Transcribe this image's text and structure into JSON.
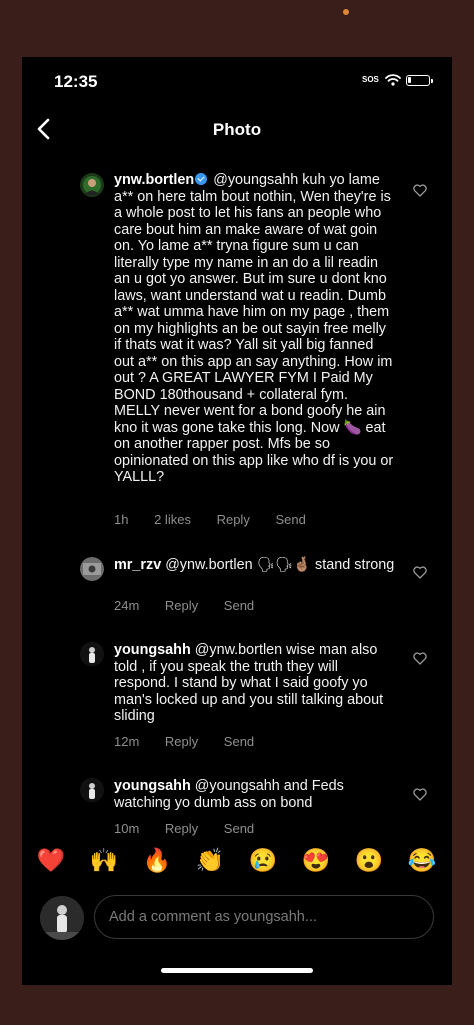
{
  "status_bar": {
    "time": "12:35",
    "sos": "SOS"
  },
  "nav": {
    "title": "Photo"
  },
  "comments": [
    {
      "username": "ynw.bortlen",
      "verified": true,
      "text": "@youngsahh kuh yo lame a** on here talm bout nothin, Wen they're is a whole post to let his fans an people who care bout him an make aware of wat goin on. Yo lame a** tryna figure sum u can literally type my name in an do a lil readin an u got yo answer. But im sure u dont kno laws, want understand wat u readin. Dumb a** wat umma have him on my page , them on my highlights an be out sayin free melly if thats wat it was? Yall sit yall big fanned out a** on this app an say anything. How im out ? A GREAT LAWYER FYM I Paid My BOND 180thousand + collateral fym. MELLY never went for a bond goofy he ain kno it was gone take this long. Now 🍆 eat on another rapper post. Mfs be so opinionated on this app like who df is you or YALLL?",
      "time": "1h",
      "likes": "2 likes",
      "reply": "Reply",
      "send": "Send"
    },
    {
      "username": "mr_rzv",
      "verified": false,
      "text": "@ynw.bortlen 🗣🗣🤞🏽 stand strong",
      "time": "24m",
      "reply": "Reply",
      "send": "Send"
    },
    {
      "username": "youngsahh",
      "verified": false,
      "text": "@ynw.bortlen wise man also told , if you speak the truth they will respond. I stand by what I said goofy yo man's locked up and you still talking about sliding",
      "time": "12m",
      "reply": "Reply",
      "send": "Send"
    },
    {
      "username": "youngsahh",
      "verified": false,
      "text": "@youngsahh and Feds watching yo dumb ass on bond",
      "time": "10m",
      "reply": "Reply",
      "send": "Send"
    }
  ],
  "emoji_bar": [
    "❤️",
    "🙌",
    "🔥",
    "👏",
    "😢",
    "😍",
    "😮",
    "😂"
  ],
  "comment_input": {
    "placeholder": "Add a comment as youngsahh..."
  },
  "colors": {
    "background": "#000000",
    "muted_text": "#8e8e8e",
    "verified_blue": "#3897f0",
    "frame": "#3a1e19"
  }
}
